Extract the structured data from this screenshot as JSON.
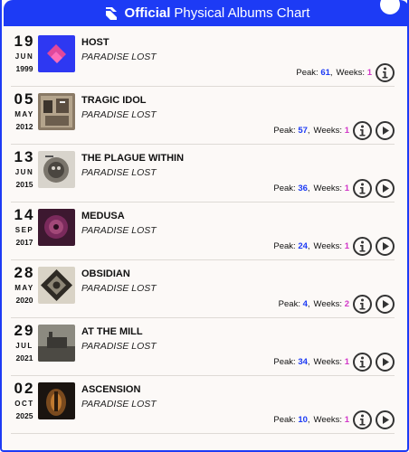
{
  "header": {
    "brand": "Official",
    "title": "Physical Albums Chart"
  },
  "colors": {
    "accent": "#1d3bf5",
    "peak": "#1d3bf5",
    "weeks": "#d237c8"
  },
  "labels": {
    "peak": "Peak:",
    "weeks": "Weeks:"
  },
  "entries": [
    {
      "day": "19",
      "month": "JUN",
      "year": "1999",
      "album": "HOST",
      "artist": "PARADISE LOST",
      "peak": "61",
      "weeks": "1",
      "has_play": false,
      "cover": "host"
    },
    {
      "day": "05",
      "month": "MAY",
      "year": "2012",
      "album": "TRAGIC IDOL",
      "artist": "PARADISE LOST",
      "peak": "57",
      "weeks": "1",
      "has_play": true,
      "cover": "tragic"
    },
    {
      "day": "13",
      "month": "JUN",
      "year": "2015",
      "album": "THE PLAGUE WITHIN",
      "artist": "PARADISE LOST",
      "peak": "36",
      "weeks": "1",
      "has_play": true,
      "cover": "plague"
    },
    {
      "day": "14",
      "month": "SEP",
      "year": "2017",
      "album": "MEDUSA",
      "artist": "PARADISE LOST",
      "peak": "24",
      "weeks": "1",
      "has_play": true,
      "cover": "medusa"
    },
    {
      "day": "28",
      "month": "MAY",
      "year": "2020",
      "album": "OBSIDIAN",
      "artist": "PARADISE LOST",
      "peak": "4",
      "weeks": "2",
      "has_play": true,
      "cover": "obsidian"
    },
    {
      "day": "29",
      "month": "JUL",
      "year": "2021",
      "album": "AT THE MILL",
      "artist": "PARADISE LOST",
      "peak": "34",
      "weeks": "1",
      "has_play": true,
      "cover": "mill"
    },
    {
      "day": "02",
      "month": "OCT",
      "year": "2025",
      "album": "ASCENSION",
      "artist": "PARADISE LOST",
      "peak": "10",
      "weeks": "1",
      "has_play": true,
      "cover": "ascension"
    }
  ]
}
